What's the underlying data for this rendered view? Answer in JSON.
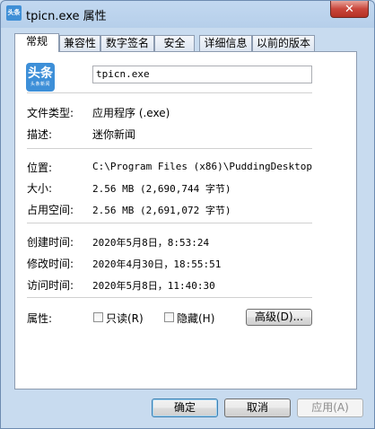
{
  "window": {
    "title": "tpicn.exe 属性",
    "close_label": "✕"
  },
  "tabs": [
    {
      "label": "常规"
    },
    {
      "label": "兼容性"
    },
    {
      "label": "数字签名"
    },
    {
      "label": "安全"
    },
    {
      "label": "详细信息"
    },
    {
      "label": "以前的版本"
    }
  ],
  "app_icon": {
    "main": "头条",
    "sub": "头条新闻"
  },
  "file_name": "tpicn.exe",
  "fields": {
    "type": {
      "label": "文件类型:",
      "value": "应用程序 (.exe)"
    },
    "description": {
      "label": "描述:",
      "value": "迷你新闻"
    },
    "location": {
      "label": "位置:",
      "value": "C:\\Program Files (x86)\\PuddingDesktop"
    },
    "size": {
      "label": "大小:",
      "value": "2.56 MB (2,690,744 字节)"
    },
    "size_on_disk": {
      "label": "占用空间:",
      "value": "2.56 MB (2,691,072 字节)"
    },
    "created": {
      "label": "创建时间:",
      "value": "2020年5月8日，8:53:24"
    },
    "modified": {
      "label": "修改时间:",
      "value": "2020年4月30日，18:55:51"
    },
    "accessed": {
      "label": "访问时间:",
      "value": "2020年5月8日，11:40:30"
    }
  },
  "attributes": {
    "label": "属性:",
    "readonly_label": "只读(R)",
    "hidden_label": "隐藏(H)",
    "advanced_label": "高级(D)..."
  },
  "buttons": {
    "ok": "确定",
    "cancel": "取消",
    "apply": "应用(A)"
  }
}
